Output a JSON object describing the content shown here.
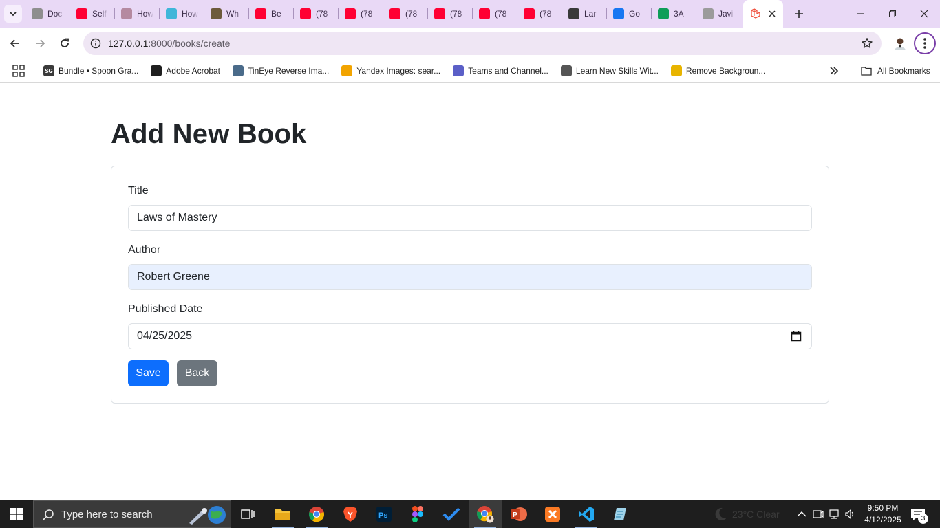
{
  "browser": {
    "tabs": [
      {
        "title": "Doc",
        "favicon": "doc-globe-icon",
        "color": "#8e8e8e"
      },
      {
        "title": "Self",
        "favicon": "youtube-icon",
        "color": "#ff0033"
      },
      {
        "title": "How",
        "favicon": "puzzle-icon",
        "color": "#b58aa0"
      },
      {
        "title": "How",
        "favicon": "t-icon",
        "color": "#3fb6d9"
      },
      {
        "title": "Wh",
        "favicon": "photo-icon",
        "color": "#6d5a3b"
      },
      {
        "title": "Be",
        "favicon": "youtube-icon",
        "color": "#ff0033"
      },
      {
        "title": "(78",
        "favicon": "youtube-icon",
        "color": "#ff0033"
      },
      {
        "title": "(78",
        "favicon": "youtube-icon",
        "color": "#ff0033"
      },
      {
        "title": "(78",
        "favicon": "youtube-icon",
        "color": "#ff0033"
      },
      {
        "title": "(78",
        "favicon": "youtube-icon",
        "color": "#ff0033"
      },
      {
        "title": "(78",
        "favicon": "youtube-icon",
        "color": "#ff0033"
      },
      {
        "title": "(78",
        "favicon": "youtube-icon",
        "color": "#ff0033"
      },
      {
        "title": "Lar",
        "favicon": "openai-icon",
        "color": "#3a3a3a"
      },
      {
        "title": "Go",
        "favicon": "messenger-icon",
        "color": "#1877f2"
      },
      {
        "title": "3A",
        "favicon": "sheets-icon",
        "color": "#0f9d58"
      },
      {
        "title": "Javi",
        "favicon": "github-icon",
        "color": "#9b9b9b"
      }
    ],
    "active_tab": {
      "favicon": "laravel-icon",
      "color": "#f05340"
    },
    "url_host": "127.0.0.1",
    "url_path": ":8000/books/create",
    "bookmarks": [
      {
        "label": "Bundle • Spoon Gra...",
        "icon": "sg-icon",
        "color": "#3a3a3a",
        "glyph": "SG"
      },
      {
        "label": "Adobe Acrobat",
        "icon": "acrobat-icon",
        "color": "#1f1f1f",
        "glyph": ""
      },
      {
        "label": "TinEye Reverse Ima...",
        "icon": "tineye-icon",
        "color": "#4a6b8a",
        "glyph": ""
      },
      {
        "label": "Yandex Images: sear...",
        "icon": "yandex-images-icon",
        "color": "#f2a400",
        "glyph": ""
      },
      {
        "label": "Teams and Channel...",
        "icon": "teams-icon",
        "color": "#5b5fc7",
        "glyph": ""
      },
      {
        "label": "Learn New Skills Wit...",
        "icon": "skillshare-icon",
        "color": "#555555",
        "glyph": ""
      },
      {
        "label": "Remove Backgroun...",
        "icon": "removebg-icon",
        "color": "#e8b400",
        "glyph": ""
      }
    ],
    "all_bookmarks_label": "All Bookmarks"
  },
  "page": {
    "title": "Add New Book",
    "form": {
      "title_label": "Title",
      "title_value": "Laws of Mastery",
      "author_label": "Author",
      "author_value": "Robert Greene",
      "date_label": "Published Date",
      "date_value": "04/25/2025",
      "save_label": "Save",
      "back_label": "Back"
    },
    "colors": {
      "primary": "#0d6efd",
      "secondary": "#6c757d",
      "autofill": "#e8f0fe"
    }
  },
  "taskbar": {
    "search_placeholder": "Type here to search",
    "weather": "23°C  Clear",
    "time": "9:50 PM",
    "date": "4/12/2025",
    "notification_count": "3"
  }
}
